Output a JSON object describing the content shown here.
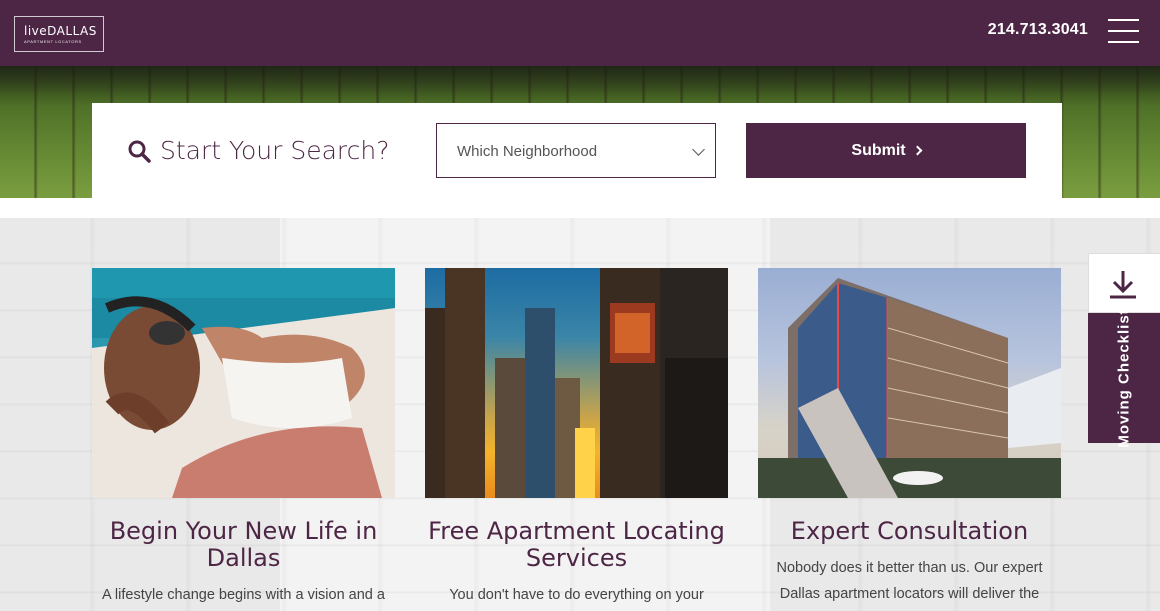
{
  "header": {
    "logo_main": "liveDALLAS",
    "logo_sub": "APARTMENT LOCATORS",
    "phone": "214.713.3041",
    "menu_icon": "hamburger-menu-icon"
  },
  "search": {
    "icon": "search-icon",
    "title": "Start Your Search?",
    "neighborhood_select": "Which Neighborhood",
    "submit_label": "Submit"
  },
  "cards": [
    {
      "title": "Begin Your New Life in Dallas",
      "text": "A lifestyle change begins with a vision and a"
    },
    {
      "title": "Free Apartment Locating Services",
      "text": "You don't have to do everything on your"
    },
    {
      "title": "Expert Consultation",
      "text": "Nobody does it better than us. Our expert Dallas apartment locators will deliver the"
    }
  ],
  "side_tab": {
    "icon": "download-icon",
    "label": "Moving Checklist"
  },
  "colors": {
    "brand": "#4d2645",
    "white": "#ffffff"
  }
}
